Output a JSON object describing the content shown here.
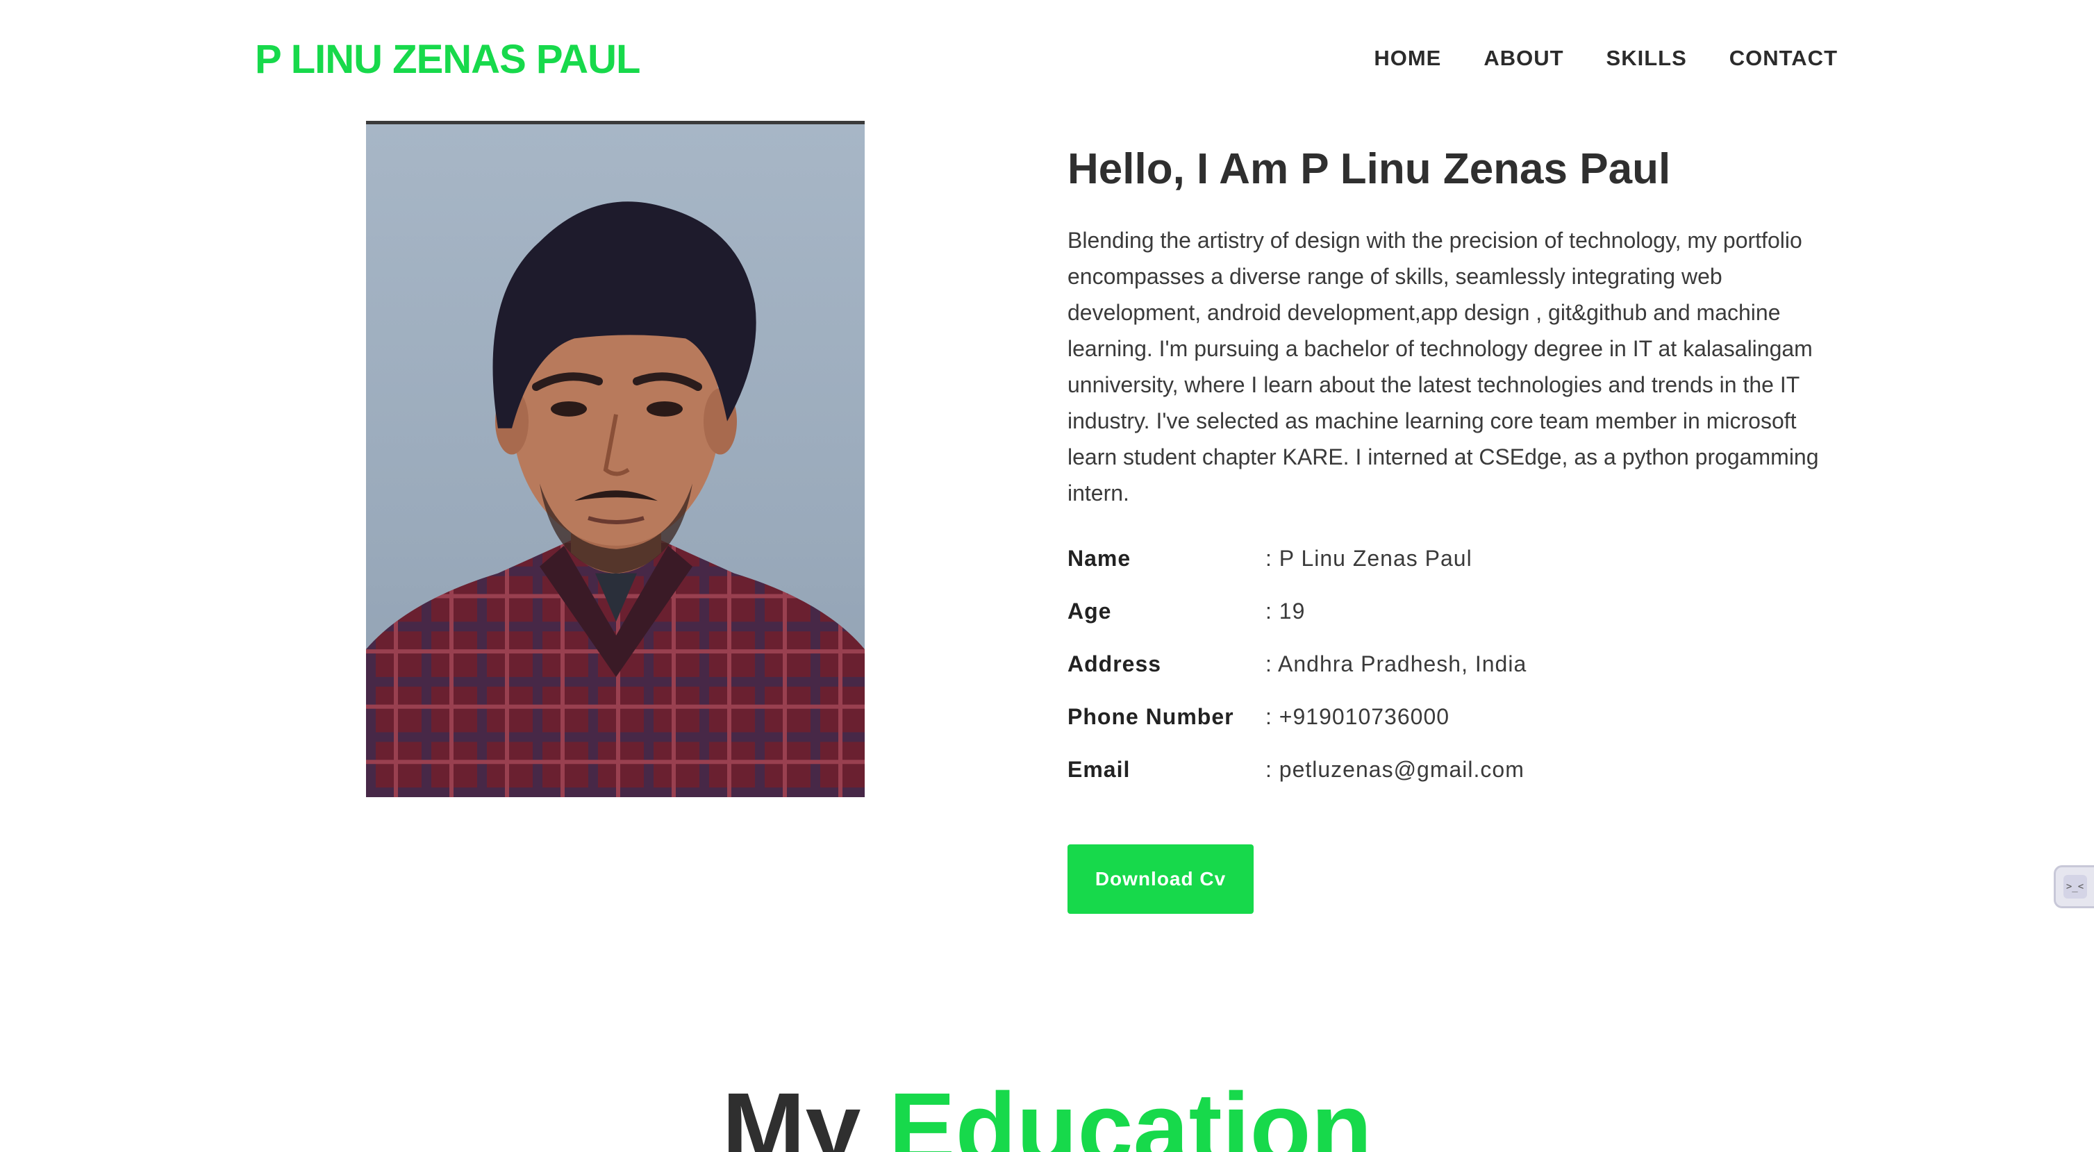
{
  "header": {
    "logo": "P LINU ZENAS PAUL",
    "nav": [
      "HOME",
      "ABOUT",
      "SKILLS",
      "CONTACT"
    ]
  },
  "about": {
    "heading": "Hello, I Am P Linu Zenas Paul",
    "description": "Blending the artistry of design with the precision of technology, my portfolio encompasses a diverse range of skills, seamlessly integrating web development, android development,app design , git&github and machine learning. I'm pursuing a bachelor of technology degree in IT at kalasalingam unniversity, where I learn about the latest technologies and trends in the IT industry. I've selected as machine learning core team member in microsoft learn student chapter KARE. I interned at CSEdge, as a python progamming intern.",
    "info": [
      {
        "label": "Name",
        "value": ": P Linu Zenas Paul"
      },
      {
        "label": "Age",
        "value": ": 19"
      },
      {
        "label": "Address",
        "value": ": Andhra Pradhesh, India"
      },
      {
        "label": "Phone Number",
        "value": ": +919010736000"
      },
      {
        "label": "Email",
        "value": ": petluzenas@gmail.com"
      }
    ],
    "button_label": "Download Cv"
  },
  "education": {
    "title_part1": "My",
    "title_part2": "Education"
  },
  "side_widget": {
    "glyph": ">_<"
  },
  "colors": {
    "accent": "#17d94b",
    "text": "#333333",
    "background": "#ffffff"
  }
}
